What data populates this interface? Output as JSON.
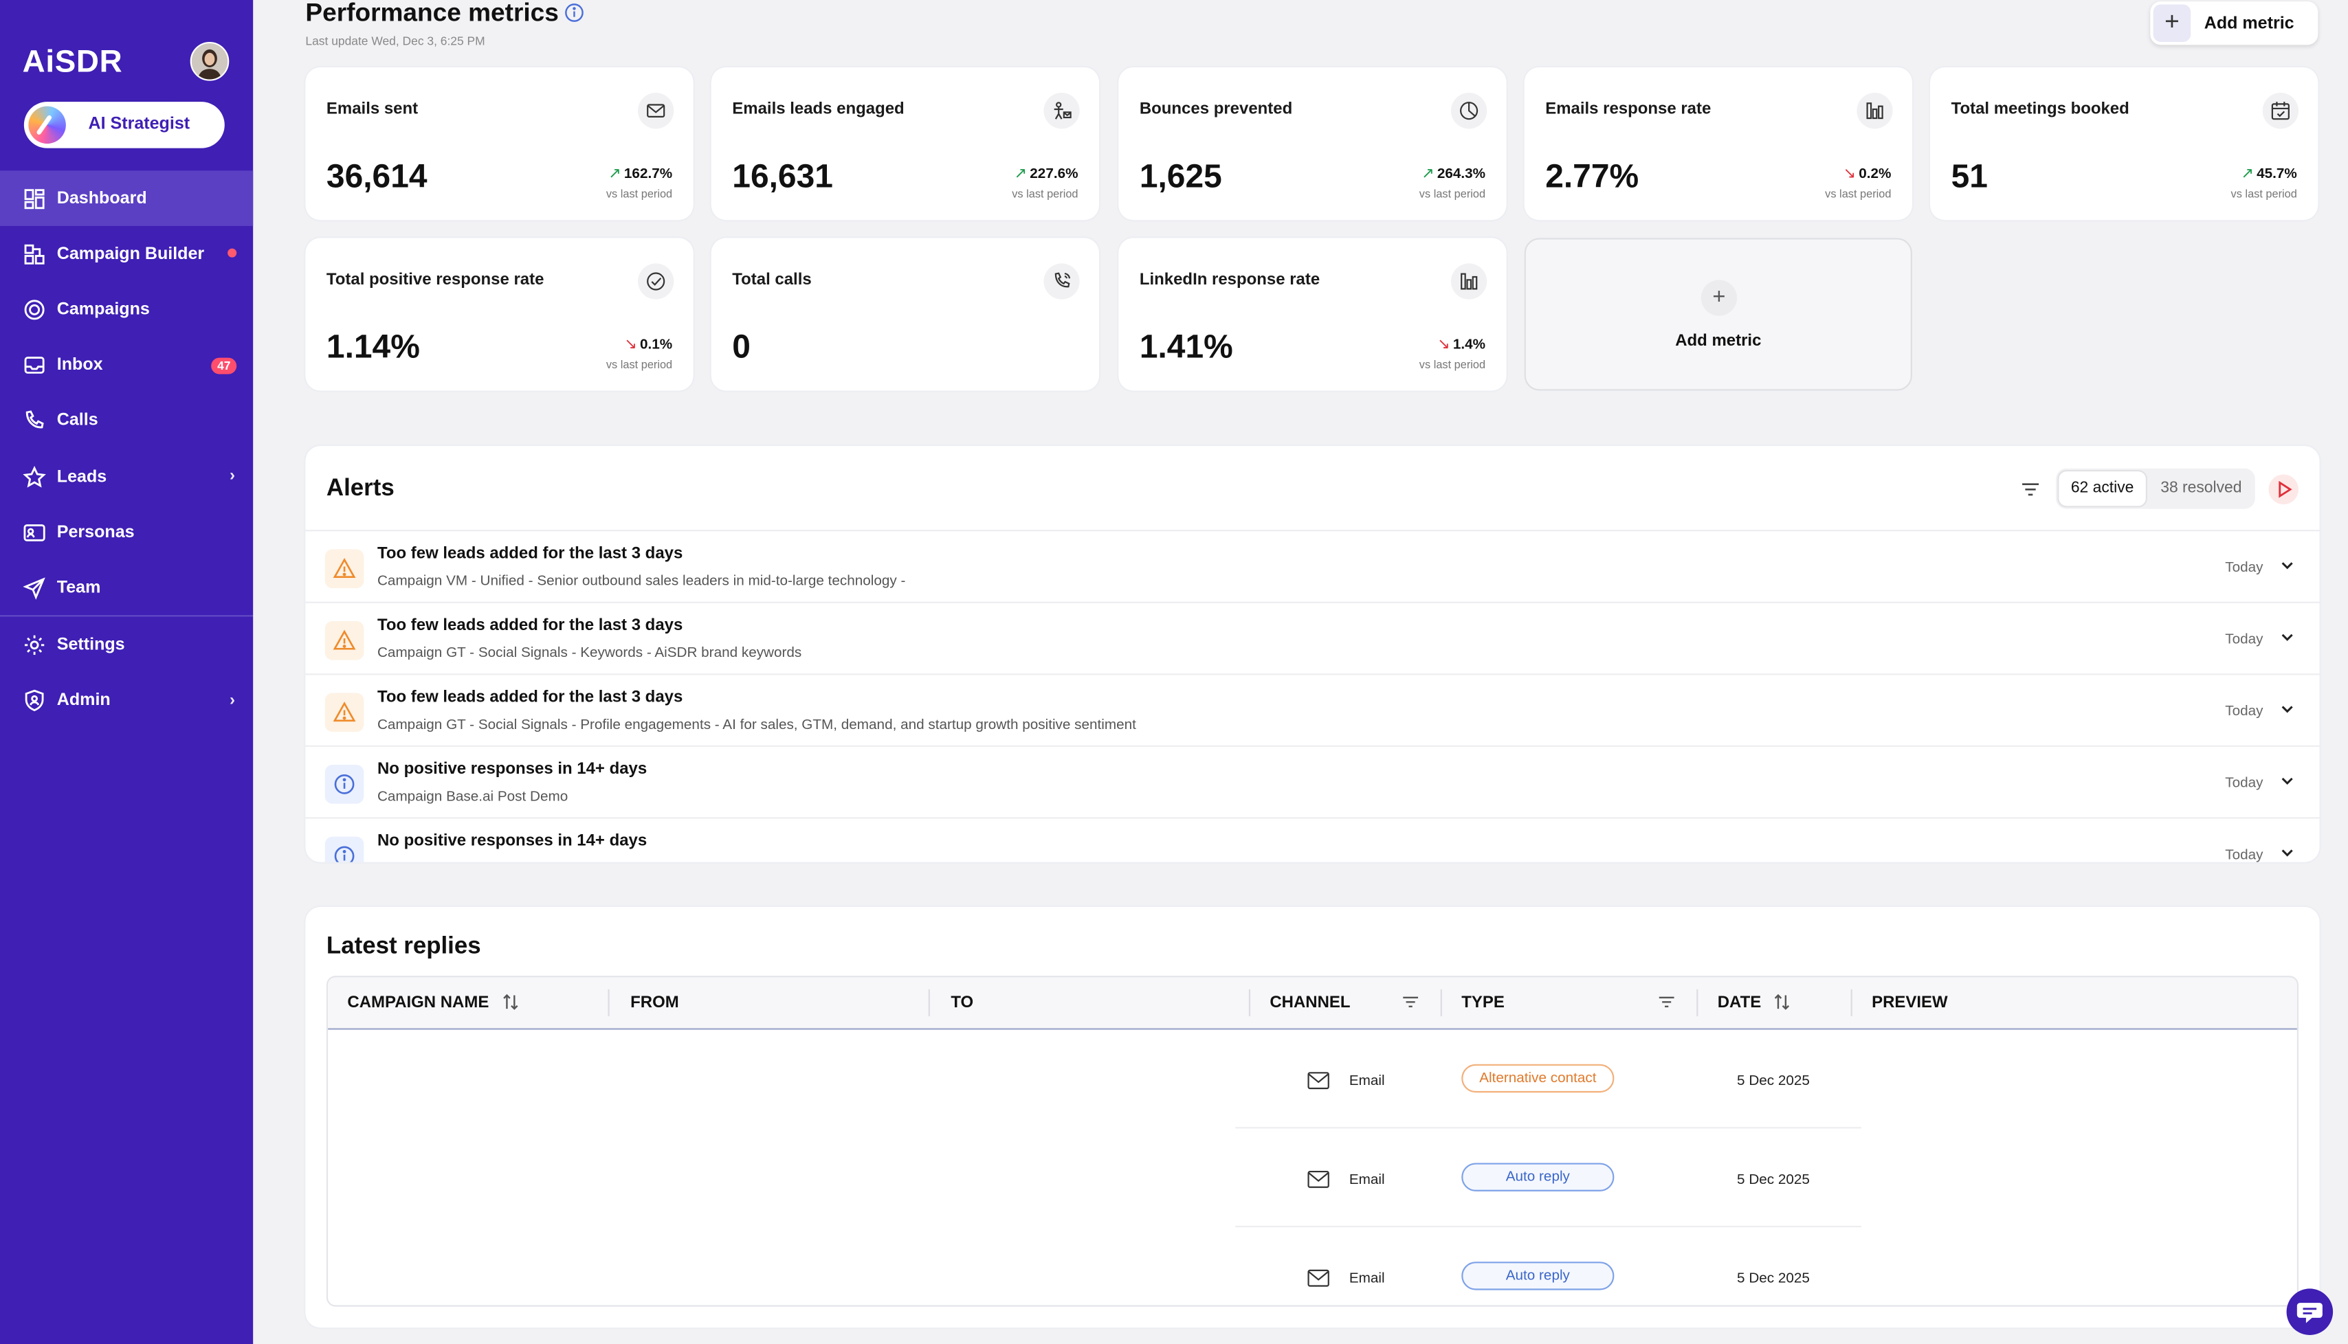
{
  "sidebar": {
    "logo": "AiSDR",
    "strategist_label": "AI Strategist",
    "items": [
      {
        "label": "Dashboard"
      },
      {
        "label": "Campaign Builder"
      },
      {
        "label": "Campaigns"
      },
      {
        "label": "Inbox",
        "badge": "47"
      },
      {
        "label": "Calls"
      },
      {
        "label": "Leads"
      },
      {
        "label": "Personas"
      },
      {
        "label": "Team"
      },
      {
        "label": "Settings"
      },
      {
        "label": "Admin"
      }
    ]
  },
  "header": {
    "title": "Performance metrics",
    "last_update": "Last update Wed, Dec 3, 6:25 PM",
    "add_metric": "Add metric"
  },
  "metrics": [
    {
      "label": "Emails sent",
      "value": "36,614",
      "delta": "162.7%",
      "direction": "up",
      "icon": "mail-icon"
    },
    {
      "label": "Emails leads engaged",
      "value": "16,631",
      "delta": "227.6%",
      "direction": "up",
      "icon": "engaged-icon"
    },
    {
      "label": "Bounces prevented",
      "value": "1,625",
      "delta": "264.3%",
      "direction": "up",
      "icon": "pie-icon"
    },
    {
      "label": "Emails response rate",
      "value": "2.77%",
      "delta": "0.2%",
      "direction": "down",
      "icon": "bars-icon"
    },
    {
      "label": "Total meetings booked",
      "value": "51",
      "delta": "45.7%",
      "direction": "up",
      "icon": "calendar-icon"
    },
    {
      "label": "Total positive response rate",
      "value": "1.14%",
      "delta": "0.1%",
      "direction": "down",
      "icon": "check-circle-icon"
    },
    {
      "label": "Total calls",
      "value": "0",
      "delta": "",
      "direction": "",
      "icon": "phone-icon"
    },
    {
      "label": "LinkedIn response rate",
      "value": "1.41%",
      "delta": "1.4%",
      "direction": "down",
      "icon": "bars-icon"
    }
  ],
  "vs_label": "vs last period",
  "add_metric_card": "Add metric",
  "alerts": {
    "title": "Alerts",
    "active": "62 active",
    "resolved": "38 resolved",
    "rows": [
      {
        "type": "warning",
        "title": "Too few leads added for the last 3 days",
        "sub": "Campaign VM - Unified - Senior outbound sales leaders in mid-to-large technology -",
        "date": "Today"
      },
      {
        "type": "warning",
        "title": "Too few leads added for the last 3 days",
        "sub": "Campaign GT - Social Signals - Keywords - AiSDR brand keywords",
        "date": "Today"
      },
      {
        "type": "warning",
        "title": "Too few leads added for the last 3 days",
        "sub": "Campaign GT - Social Signals - Profile engagements - AI for sales, GTM, demand, and startup growth positive sentiment",
        "date": "Today"
      },
      {
        "type": "info",
        "title": "No positive responses in 14+ days",
        "sub": "Campaign Base.ai Post Demo",
        "date": "Today"
      },
      {
        "type": "info",
        "title": "No positive responses in 14+ days",
        "sub": "",
        "date": "Today"
      }
    ]
  },
  "replies": {
    "title": "Latest replies",
    "columns": [
      "CAMPAIGN NAME",
      "FROM",
      "TO",
      "CHANNEL",
      "TYPE",
      "DATE",
      "PREVIEW"
    ],
    "rows": [
      {
        "channel": "Email",
        "type": "Alternative contact",
        "type_color": "orange",
        "date": "5 Dec 2025"
      },
      {
        "channel": "Email",
        "type": "Auto reply",
        "type_color": "blue",
        "date": "5 Dec 2025"
      },
      {
        "channel": "Email",
        "type": "Auto reply",
        "type_color": "blue",
        "date": "5 Dec 2025"
      }
    ]
  },
  "colors": {
    "sidebar": "#3f1fb4",
    "active_item": "#5b40c4",
    "up": "#1a9a4a",
    "down": "#e0303a"
  }
}
